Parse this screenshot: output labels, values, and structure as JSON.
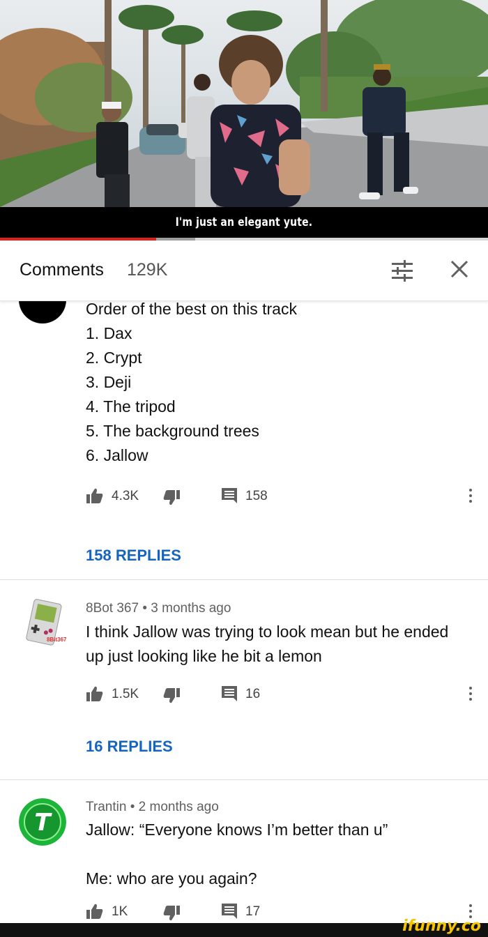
{
  "video": {
    "subtitle": "I'm just an elegant yute.",
    "progress_fraction": 0.32,
    "buffer_fraction": 0.4
  },
  "comments_header": {
    "title": "Comments",
    "count": "129K",
    "filter_icon": "sort-filter-icon",
    "close_icon": "close-icon"
  },
  "comments": [
    {
      "author": "",
      "age": "",
      "text_lines": [
        "Order of the best on this track",
        "1. Dax",
        "2. Crypt",
        "3. Deji",
        "4. The tripod",
        "5. The background trees",
        "6. Jallow"
      ],
      "likes": "4.3K",
      "reply_count": "158",
      "replies_label": "158 REPLIES"
    },
    {
      "author": "8Bot 367",
      "age": "3 months ago",
      "text_lines": [
        "I think Jallow was trying to look mean but he ended",
        "up just looking like he bit a lemon"
      ],
      "likes": "1.5K",
      "reply_count": "16",
      "replies_label": "16 REPLIES",
      "avatar_label": "8Bit367"
    },
    {
      "author": "Trantin",
      "age": "2 months ago",
      "text_lines": [
        "Jallow: “Everyone knows I’m better than u”",
        "",
        "Me: who are you again?"
      ],
      "likes": "1K",
      "reply_count": "17",
      "avatar_letter": "T"
    }
  ],
  "icons": {
    "like": "thumbs-up-icon",
    "dislike": "thumbs-down-icon",
    "reply": "comment-icon",
    "more": "more-vert-icon"
  },
  "watermark": "ifunny.co",
  "colors": {
    "progress": "#e0201b",
    "link": "#1565c0",
    "avatar_green": "#1db43a",
    "watermark": "#f5c400"
  }
}
